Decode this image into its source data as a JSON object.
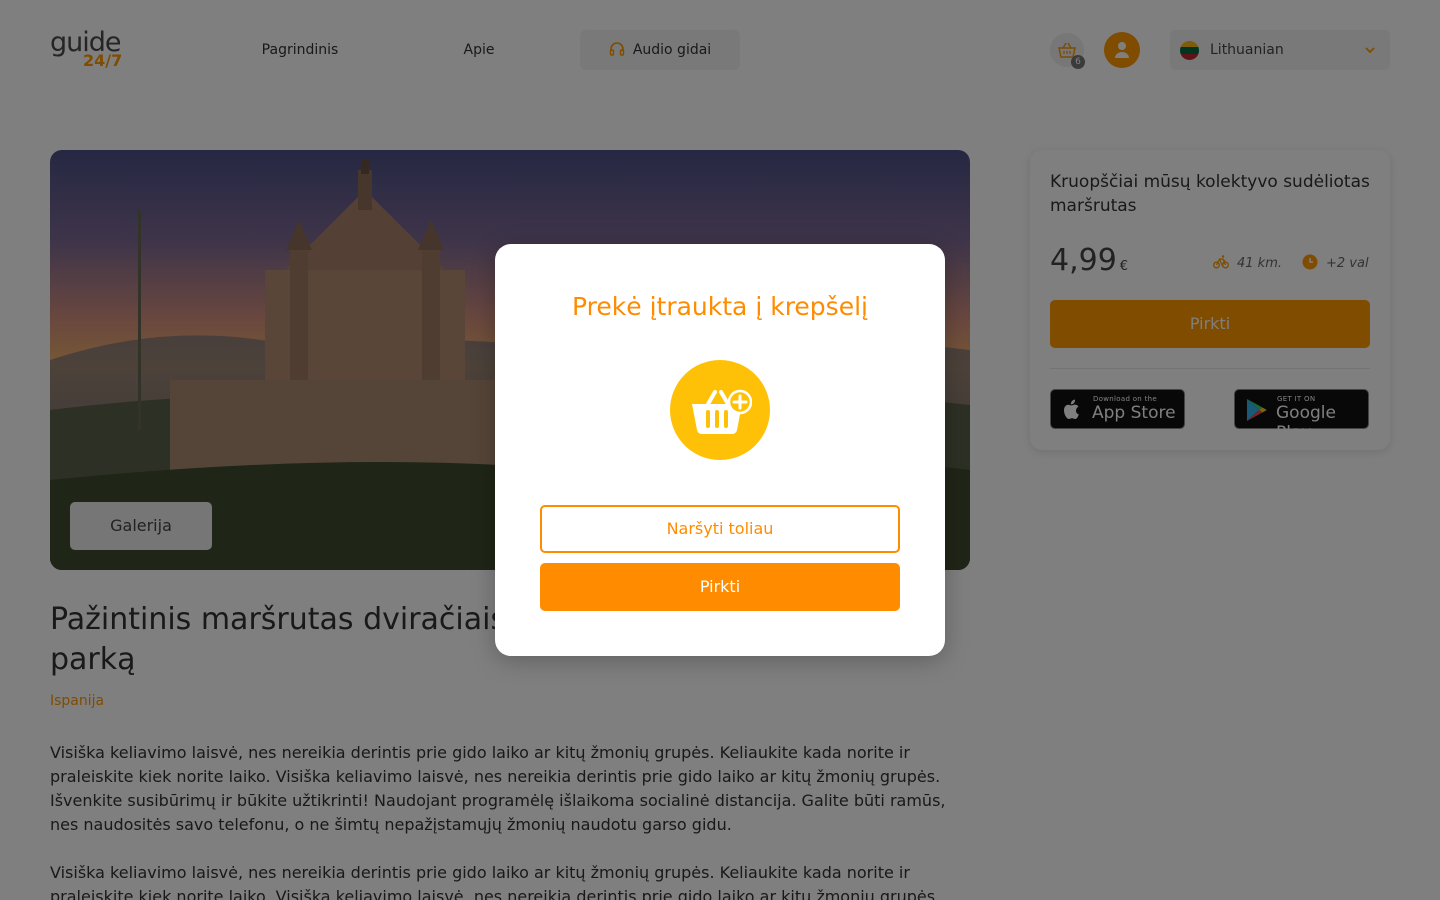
{
  "header": {
    "logo_line1": "guide",
    "logo_line2": "24/7",
    "nav": {
      "home": "Pagrindinis",
      "about": "Apie",
      "audio": "Audio gidai"
    },
    "cart_count": "6",
    "language": "Lithuanian"
  },
  "main": {
    "gallery_label": "Galerija",
    "title": "Pažintinis maršrutas dviračiais per Aukštadvario regioninį parką",
    "country": "Ispanija",
    "description_1": "Visiška keliavimo laisvė, nes nereikia derintis prie gido laiko ar kitų žmonių grupės. Keliaukite kada norite ir praleiskite kiek norite laiko. Visiška keliavimo laisvė, nes nereikia derintis prie gido laiko ar kitų žmonių grupės. Išvenkite susibūrimų ir būkite užtikrinti! Naudojant programėlę išlaikoma socialinė distancija. Galite būti ramūs, nes naudositės savo telefonu, o ne šimtų nepažįstamųjų žmonių naudotu garso gidu.",
    "description_2": "Visiška keliavimo laisvė, nes nereikia derintis prie gido laiko ar kitų žmonių grupės. Keliaukite kada norite ir praleiskite kiek norite laiko. Visiška keliavimo laisvė, nes nereikia derintis prie gido laiko ar kitų žmonių grupės."
  },
  "card": {
    "title": "Kruopščiai mūsų kolektyvo sudėliotas maršrutas",
    "price": "4,99",
    "currency": "€",
    "distance": "41 km.",
    "duration": "+2 val",
    "buy_label": "Pirkti",
    "appstore_small": "Download on the",
    "appstore_big": "App Store",
    "gplay_small": "GET IT ON",
    "gplay_big": "Google Play"
  },
  "modal": {
    "title": "Prekė įtraukta į krepšelį",
    "browse_label": "Naršyti toliau",
    "buy_label": "Pirkti"
  },
  "colors": {
    "accent": "#ff9800",
    "modal_accent": "#ff8c00",
    "icon_circle": "#ffc107"
  }
}
